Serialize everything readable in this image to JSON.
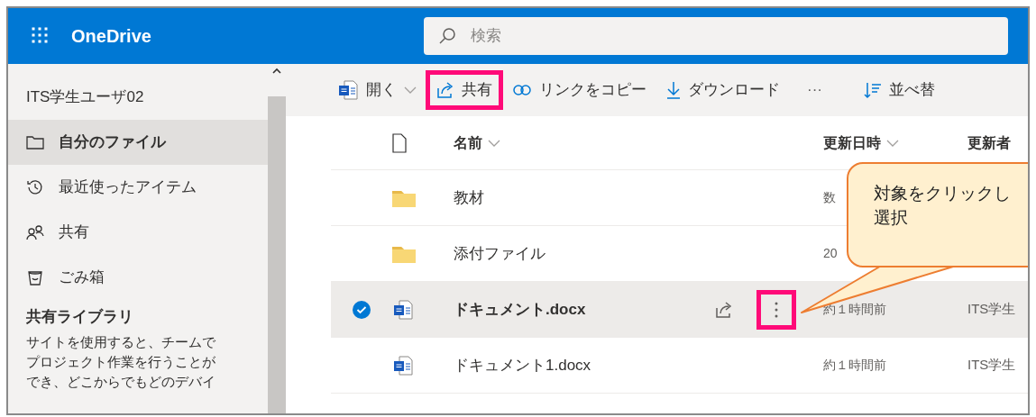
{
  "app": {
    "title": "OneDrive"
  },
  "search": {
    "placeholder": "検索"
  },
  "sidebar": {
    "user": "ITS学生ユーザ02",
    "items": [
      {
        "kind": "folder",
        "label": "自分のファイル",
        "selected": true
      },
      {
        "kind": "recent",
        "label": "最近使ったアイテム",
        "selected": false
      },
      {
        "kind": "shared",
        "label": "共有",
        "selected": false
      },
      {
        "kind": "trash",
        "label": "ごみ箱",
        "selected": false
      }
    ],
    "section_title": "共有ライブラリ",
    "description": "サイトを使用すると、チームでプロジェクト作業を行うことができ、どこからでもどのデバイ"
  },
  "toolbar": [
    {
      "kind": "open",
      "label": "開く",
      "highlighted": false
    },
    {
      "kind": "share",
      "label": "共有",
      "highlighted": true
    },
    {
      "kind": "link",
      "label": "リンクをコピー",
      "highlighted": false
    },
    {
      "kind": "download",
      "label": "ダウンロード",
      "highlighted": false
    },
    {
      "kind": "more",
      "label": "···",
      "highlighted": false
    },
    {
      "kind": "sort",
      "label": "並べ替",
      "highlighted": false
    }
  ],
  "columns": [
    {
      "kind": "type"
    },
    {
      "kind": "name",
      "label": "名前"
    },
    {
      "kind": "date",
      "label": "更新日時"
    },
    {
      "kind": "modifier",
      "label": "更新者"
    }
  ],
  "rows": [
    {
      "kind": "folder",
      "name": "教材",
      "date": "数",
      "selected": false
    },
    {
      "kind": "folder",
      "name": "添付ファイル",
      "date": "20",
      "selected": false
    },
    {
      "kind": "word",
      "name": "ドキュメント.docx",
      "date": "約１時間前",
      "modifier": "ITS学生",
      "selected": true,
      "more_highlighted": true
    },
    {
      "kind": "word",
      "name": "ドキュメント1.docx",
      "date": "約１時間前",
      "modifier": "ITS学生",
      "selected": false
    }
  ],
  "callout": {
    "lines": [
      "対象をクリックし",
      "選択"
    ]
  }
}
